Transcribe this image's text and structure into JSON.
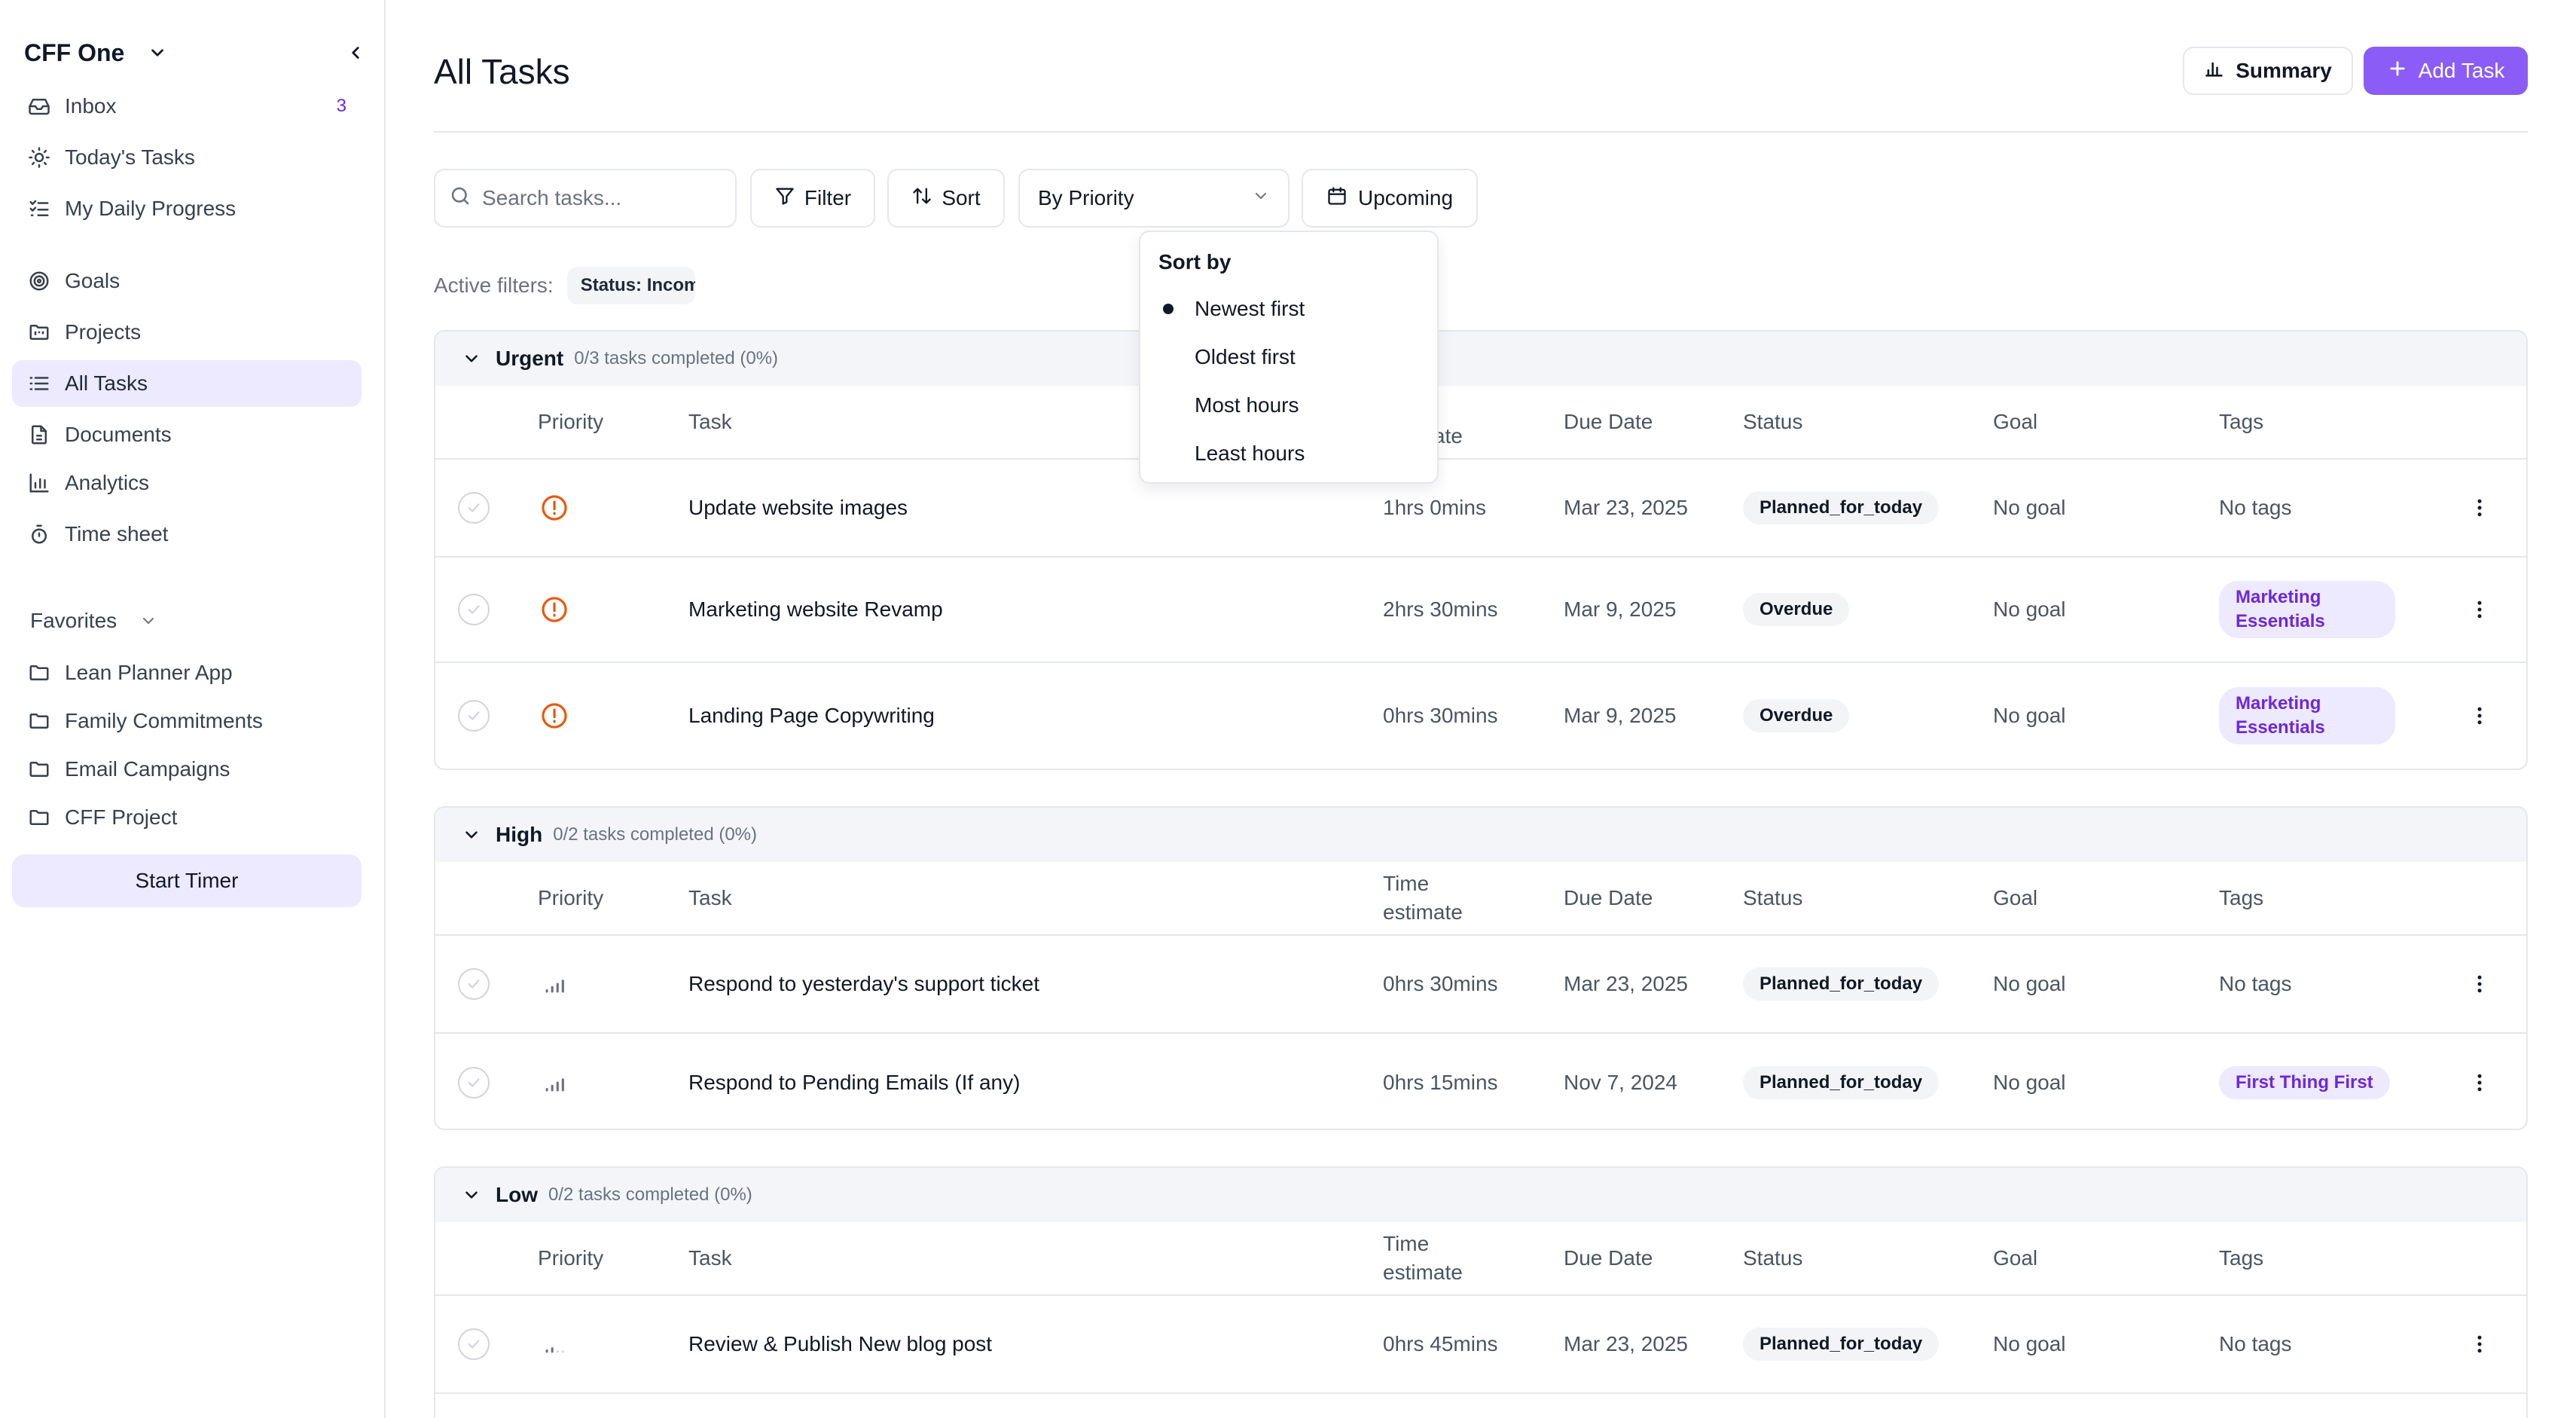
{
  "sidebar": {
    "workspace_name": "CFF One",
    "nav_primary": [
      {
        "label": "Inbox",
        "count": "3",
        "icon": "inbox-icon"
      },
      {
        "label": "Today's Tasks",
        "icon": "sun-icon"
      },
      {
        "label": "My Daily Progress",
        "icon": "checklist-icon"
      }
    ],
    "nav_secondary": [
      {
        "label": "Goals",
        "icon": "target-icon"
      },
      {
        "label": "Projects",
        "icon": "folder-kanban-icon"
      },
      {
        "label": "All Tasks",
        "icon": "list-icon",
        "active": true
      },
      {
        "label": "Documents",
        "icon": "document-icon"
      },
      {
        "label": "Analytics",
        "icon": "bar-chart-icon"
      },
      {
        "label": "Time sheet",
        "icon": "timer-icon"
      }
    ],
    "favorites_label": "Favorites",
    "favorites": [
      {
        "label": "Lean Planner App"
      },
      {
        "label": "Family Commitments"
      },
      {
        "label": "Email Campaigns"
      },
      {
        "label": "CFF Project"
      }
    ],
    "start_timer_label": "Start Timer"
  },
  "header": {
    "title": "All Tasks",
    "summary_label": "Summary",
    "add_task_label": "Add Task"
  },
  "toolbar": {
    "search_placeholder": "Search tasks...",
    "filter_label": "Filter",
    "sort_label": "Sort",
    "group_by_value": "By Priority",
    "upcoming_label": "Upcoming"
  },
  "active_filters": {
    "label": "Active filters:",
    "chips": [
      "Status: Incom"
    ]
  },
  "sort_dropdown": {
    "title": "Sort by",
    "options": [
      {
        "label": "Newest first",
        "selected": true
      },
      {
        "label": "Oldest first"
      },
      {
        "label": "Most hours"
      },
      {
        "label": "Least hours"
      }
    ]
  },
  "columns": {
    "priority": "Priority",
    "task": "Task",
    "time_estimate": "Time estimate",
    "due_date": "Due Date",
    "status": "Status",
    "goal": "Goal",
    "tags": "Tags"
  },
  "groups": [
    {
      "name": "Urgent",
      "progress": "0/3 tasks completed (0%)",
      "tasks": [
        {
          "task": "Update website images",
          "time_estimate": "1hrs 0mins",
          "due_date": "Mar 23, 2025",
          "status": "Planned_for_today",
          "goal": "No goal",
          "tags": "No tags"
        },
        {
          "task": "Marketing website Revamp",
          "time_estimate": "2hrs 30mins",
          "due_date": "Mar 9, 2025",
          "status": "Overdue",
          "goal": "No goal",
          "tag_pill": "Marketing Essentials"
        },
        {
          "task": "Landing Page Copywriting",
          "time_estimate": "0hrs 30mins",
          "due_date": "Mar 9, 2025",
          "status": "Overdue",
          "goal": "No goal",
          "tag_pill": "Marketing Essentials"
        }
      ]
    },
    {
      "name": "High",
      "progress": "0/2 tasks completed (0%)",
      "tasks": [
        {
          "task": "Respond to yesterday's support ticket",
          "time_estimate": "0hrs 30mins",
          "due_date": "Mar 23, 2025",
          "status": "Planned_for_today",
          "goal": "No goal",
          "tags": "No tags"
        },
        {
          "task": "Respond to Pending Emails (If any)",
          "time_estimate": "0hrs 15mins",
          "due_date": "Nov 7, 2024",
          "status": "Planned_for_today",
          "goal": "No goal",
          "tag_pill": "First Thing First"
        }
      ]
    },
    {
      "name": "Low",
      "progress": "0/2 tasks completed (0%)",
      "tasks": [
        {
          "task": "Review & Publish New blog post",
          "time_estimate": "0hrs 45mins",
          "due_date": "Mar 23, 2025",
          "status": "Planned_for_today",
          "goal": "No goal",
          "tags": "No tags"
        }
      ]
    }
  ],
  "colors": {
    "accent": "#8b5cf6",
    "accent_light": "#ede9fe",
    "urgent": "#ea580c",
    "border": "#e5e7eb"
  }
}
